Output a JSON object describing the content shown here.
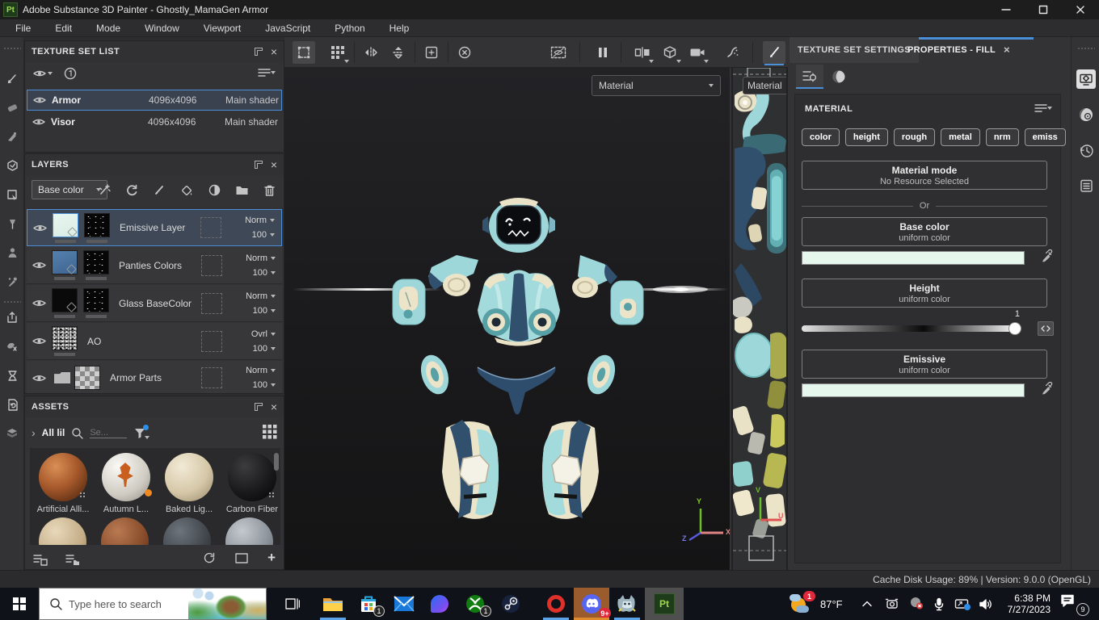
{
  "titlebar": {
    "app_icon": "Pt",
    "title": "Adobe Substance 3D Painter - Ghostly_MamaGen Armor"
  },
  "menu": {
    "items": [
      "File",
      "Edit",
      "Mode",
      "Window",
      "Viewport",
      "JavaScript",
      "Python",
      "Help"
    ]
  },
  "texture_set_list": {
    "title": "TEXTURE SET LIST",
    "rows": [
      {
        "name": "Armor",
        "resolution": "4096x4096",
        "shader": "Main shader"
      },
      {
        "name": "Visor",
        "resolution": "4096x4096",
        "shader": "Main shader"
      }
    ]
  },
  "layers": {
    "title": "LAYERS",
    "filter_value": "Base color",
    "rows": [
      {
        "name": "Emissive Layer",
        "blend": "Norm",
        "opacity": "100"
      },
      {
        "name": "Panties Colors",
        "blend": "Norm",
        "opacity": "100"
      },
      {
        "name": "Glass BaseColor",
        "blend": "Norm",
        "opacity": "100"
      },
      {
        "name": "AO",
        "blend": "Ovrl",
        "opacity": "100"
      },
      {
        "name": "Armor Parts",
        "blend": "Norm",
        "opacity": "100"
      }
    ]
  },
  "assets": {
    "title": "ASSETS",
    "breadcrumb": "All lil",
    "search_placeholder": "Se...",
    "items": [
      {
        "label": "Artificial Alli..."
      },
      {
        "label": "Autumn L..."
      },
      {
        "label": "Baked Lig..."
      },
      {
        "label": "Carbon Fiber"
      }
    ]
  },
  "viewport": {
    "material_label": "Material",
    "axis_x": "X",
    "axis_y": "Y",
    "axis_z": "Z"
  },
  "view2d": {
    "material_label": "Material",
    "axis_u": "U",
    "axis_v": "V"
  },
  "right_panel": {
    "tab_texture_set": "TEXTURE SET SETTINGS",
    "tab_properties": "PROPERTIES - FILL",
    "material_header": "MATERIAL",
    "channels": [
      "color",
      "height",
      "rough",
      "metal",
      "nrm",
      "emiss"
    ],
    "material_mode_title": "Material mode",
    "material_mode_subtitle": "No Resource Selected",
    "or_label": "Or",
    "base_color_title": "Base color",
    "base_color_subtitle": "uniform color",
    "base_color_value": "#e6f7ee",
    "height_title": "Height",
    "height_subtitle": "uniform color",
    "height_value": "1",
    "emissive_title": "Emissive",
    "emissive_subtitle": "uniform color",
    "emissive_value": "#e6f7ee"
  },
  "statusbar": {
    "text": "Cache Disk Usage:  89% | Version: 9.0.0 (OpenGL)"
  },
  "taskbar": {
    "search_placeholder": "Type here to search",
    "weather_temp": "87°F",
    "weather_badge": "1",
    "store_badge": "1",
    "xbox_badge": "1",
    "discord_badge": "9+",
    "time": "6:38 PM",
    "date": "7/27/2023",
    "notification_badge": "9",
    "app_badge": "Pt"
  },
  "icons": {
    "close": "×",
    "plus": "+",
    "chevron_right": "›"
  }
}
